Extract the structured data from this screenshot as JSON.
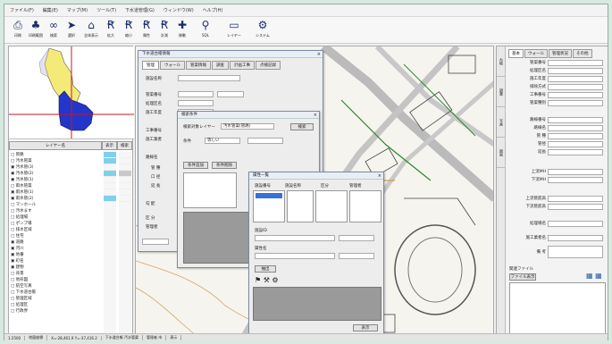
{
  "menu": [
    "ファイル(F)",
    "編集(E)",
    "マップ(M)",
    "ツール(T)",
    "下水道管理(G)",
    "ウィンドウ(W)",
    "ヘルプ(H)"
  ],
  "toolbar": [
    {
      "icon": "printer-icon",
      "label": "印刷"
    },
    {
      "icon": "stamp-icon",
      "label": "印刷範囲"
    },
    {
      "icon": "binoculars-icon",
      "label": "検索"
    },
    {
      "icon": "pointer-icon",
      "label": "選択"
    },
    {
      "icon": "home-icon",
      "label": "全体表示"
    },
    {
      "icon": "person-icon",
      "label": "拡大"
    },
    {
      "icon": "person-icon",
      "label": "縮小"
    },
    {
      "icon": "person-icon",
      "label": "属性"
    },
    {
      "icon": "person-icon",
      "label": "計測"
    },
    {
      "icon": "cross-icon",
      "label": "移動"
    },
    {
      "icon": "magnifier-icon",
      "label": "SQL"
    },
    {
      "icon": "window-icon",
      "label": "レイヤー"
    },
    {
      "icon": "gear-icon",
      "label": "システム"
    }
  ],
  "layer_panel": {
    "header": [
      "レイヤー名",
      "表示",
      "検索"
    ],
    "tree": [
      "□ 管路",
      "  □ 汚水管渠",
      "    ▣ 汚水管(3)",
      "    ▣ 汚水管(2)",
      "    ▣ 汚水管(1)",
      "  □ 雨水管渠",
      "    ▣ 雨水管(1)",
      "    ▣ 雨水管(2)",
      "  □ マンホール",
      "  □ 汚水ます",
      "  □ 処理場",
      "  □ ポンプ場",
      "  □ 排水区域",
      "  □ 住宅",
      "  ▣ 道路",
      "  ▣ 河川",
      "  ▣ 地番",
      "  ▣ 町名",
      "  ▣ 建物",
      "□ 背景",
      "  □ 地形図",
      "  □ 航空写真",
      "  □ 下水道台帳",
      "  □ 管理区域",
      "  □ 処理区",
      "  □ 行政界"
    ]
  },
  "dialog_main": {
    "title": "下水道台帳情報",
    "tabs": [
      "管理",
      "ウォール",
      "管渠情報",
      "調査",
      "計画工事",
      "点検記録"
    ],
    "fields": [
      "施設名称",
      "管渠番号",
      "処理区名",
      "施工年度",
      "工事番号",
      "施工業者",
      "路線名",
      "管 種",
      "口 径",
      "延 長",
      "勾 配",
      "区 分",
      "管理者"
    ]
  },
  "dialog_search": {
    "title": "検索条件",
    "label1": "検索対象レイヤー",
    "value1": "汚水管渠(管路)",
    "label2": "条件",
    "value2": "等しい",
    "buttons": [
      "検索",
      "条件追加",
      "条件削除"
    ]
  },
  "dialog_result": {
    "title": "属性一覧",
    "columns": [
      "施設番号",
      "施設名称",
      "区分",
      "管理者"
    ],
    "labels": [
      "施設ID",
      "属性名",
      "抽出"
    ],
    "button": "表示"
  },
  "right_panel": {
    "tabs": [
      "基本",
      "ウォール",
      "管理状況",
      "その他"
    ],
    "vtabs": [
      "台帳",
      "調書",
      "写真",
      "図面"
    ],
    "labels": [
      "管渠番号",
      "処理区名",
      "施工年度",
      "排除方式",
      "工事番号",
      "管渠種別",
      "",
      "路線番号",
      "路線名",
      "管 種",
      "管径",
      "延長",
      "",
      "上流MH",
      "下流MH",
      "",
      "上流管底高",
      "下流管底高",
      "",
      "",
      "処理場名",
      "",
      "施工業者名",
      "",
      "備 考"
    ],
    "memo": "関連ファイル",
    "memo_btn": "ファイル表示"
  },
  "status": [
    "1:2500",
    "地図座標",
    "X=-28,461.9 Y=-37,416.2",
    "下水道台帳 汚水管渠",
    "管理者 市",
    "表示"
  ]
}
